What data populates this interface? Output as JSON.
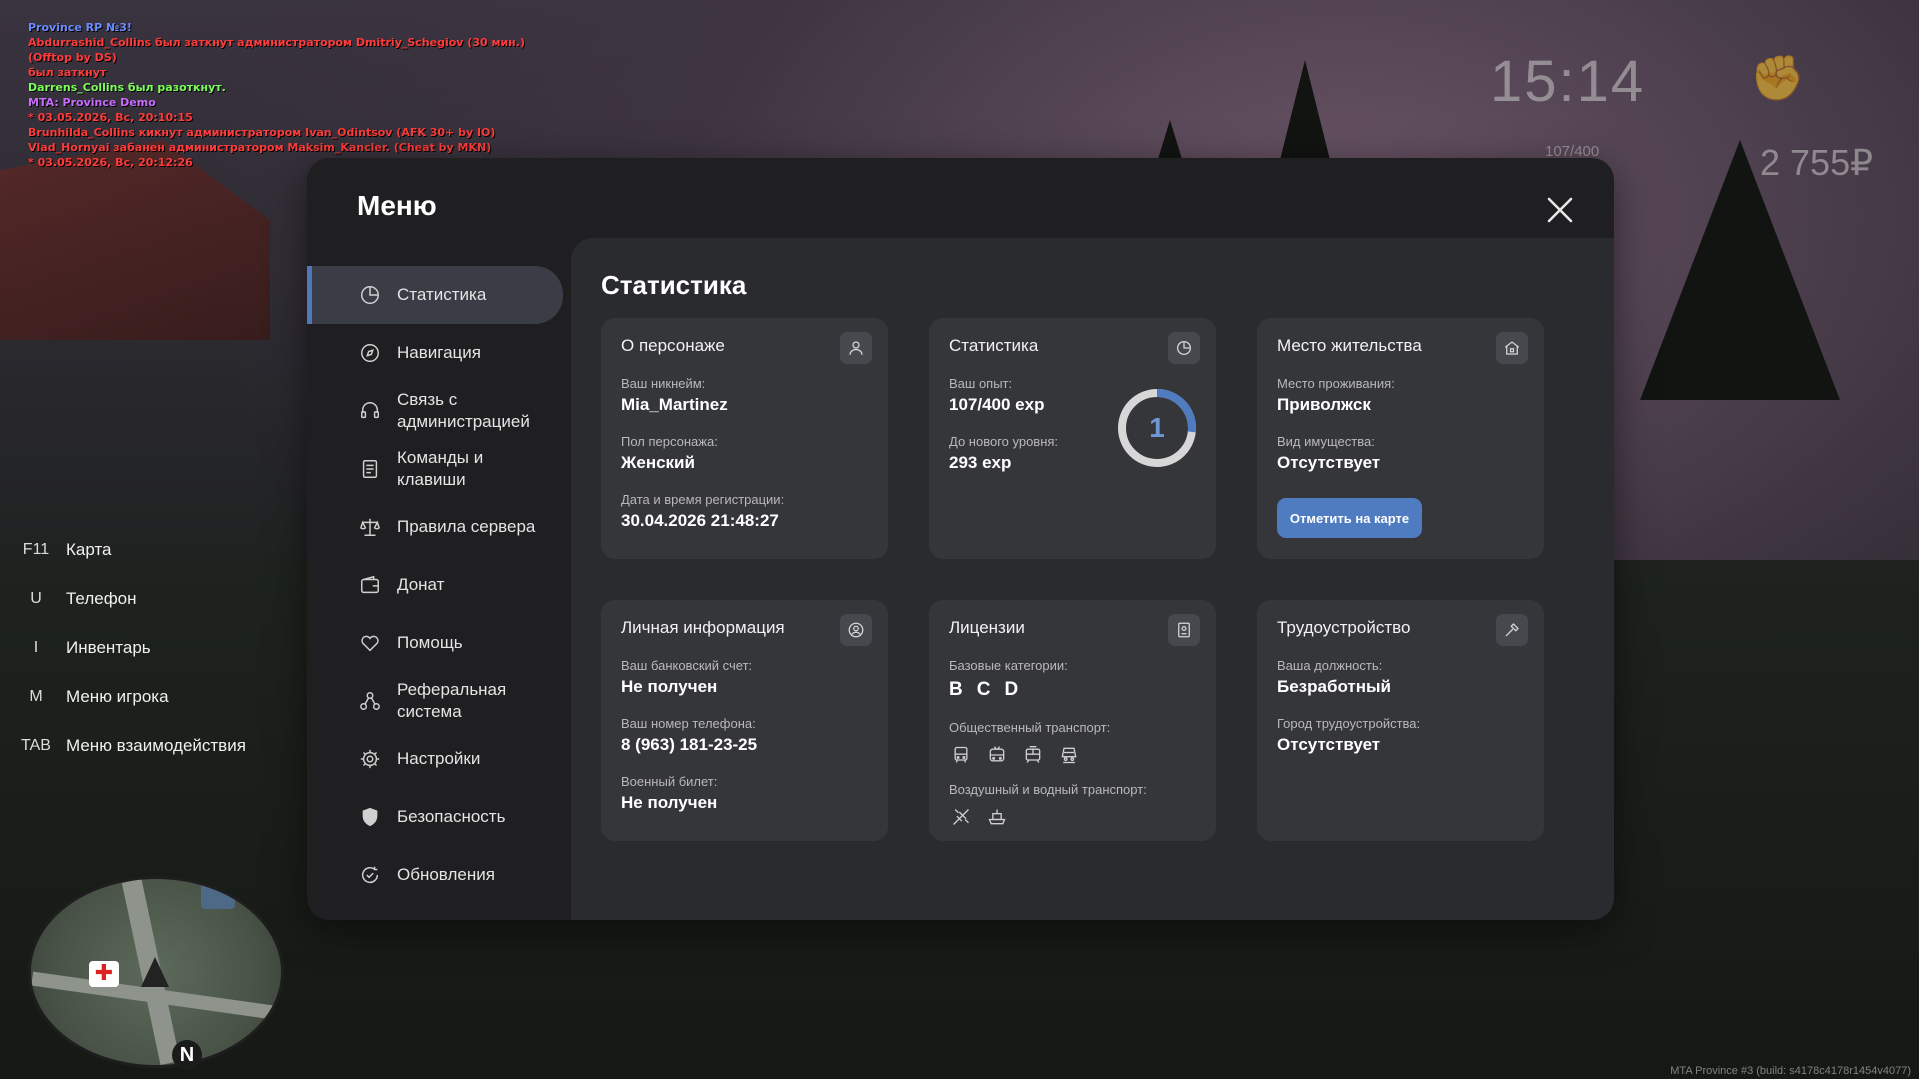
{
  "chat": [
    {
      "text": "Province RP №3!",
      "color": "#6b8cff"
    },
    {
      "text": "Abdurrashid_Collins был заткнут администратором Dmitriy_Schegiov (30 мин.)",
      "color": "#ff3b3b"
    },
    {
      "text": "(Offtop by DS)",
      "color": "#ff3b3b"
    },
    {
      "text": "был заткнут",
      "color": "#ff3b3b"
    },
    {
      "text": "Darrens_Collins был разоткнут.",
      "color": "#7cff5a"
    },
    {
      "text": "MTA: Province Demo",
      "color": "#c96bff"
    },
    {
      "text": "* 03.05.2026, Вс, 20:10:15",
      "color": "#ff3b3b"
    },
    {
      "text": "Brunhilda_Collins кикнут администратором Ivan_Odintsov (AFK 30+ by IO)",
      "color": "#ff3b3b"
    },
    {
      "text": "Vlad_Hornyai забанен администратором Maksim_Kancler. (Cheat by MKN)",
      "color": "#ff3b3b"
    },
    {
      "text": "* 03.05.2026, Вс, 20:12:26",
      "color": "#ff3b3b"
    }
  ],
  "hud": {
    "time": "15:14",
    "exp": "107/400",
    "money": "2 755₽"
  },
  "hotkeys": [
    {
      "key": "F11",
      "label": "Карта"
    },
    {
      "key": "U",
      "label": "Телефон"
    },
    {
      "key": "I",
      "label": "Инвентарь"
    },
    {
      "key": "M",
      "label": "Меню игрока"
    },
    {
      "key": "TAB",
      "label": "Меню взаимодействия"
    }
  ],
  "minimap": {
    "north": "N"
  },
  "build": "MTA Province #3 (build: s4178c4178r1454v4077)",
  "menu": {
    "title": "Меню",
    "sidebar": [
      {
        "label": "Статистика",
        "icon": "pie-chart-icon",
        "active": true
      },
      {
        "label": "Навигация",
        "icon": "compass-icon"
      },
      {
        "label": "Связь с администрацией",
        "icon": "headset-icon"
      },
      {
        "label": "Команды и клавиши",
        "icon": "document-icon"
      },
      {
        "label": "Правила сервера",
        "icon": "scales-icon"
      },
      {
        "label": "Донат",
        "icon": "wallet-icon"
      },
      {
        "label": "Помощь",
        "icon": "heart-hand-icon"
      },
      {
        "label": "Реферальная система",
        "icon": "referral-icon"
      },
      {
        "label": "Настройки",
        "icon": "gear-icon"
      },
      {
        "label": "Безопасность",
        "icon": "shield-icon"
      },
      {
        "label": "Обновления",
        "icon": "refresh-check-icon"
      }
    ],
    "content_title": "Статистика",
    "cards": {
      "character": {
        "title": "О персонаже",
        "nick_label": "Ваш никнейм:",
        "nick": "Mia_Martinez",
        "gender_label": "Пол персонажа:",
        "gender": "Женский",
        "reg_label": "Дата и время регистрации:",
        "reg": "30.04.2026 21:48:27"
      },
      "stats": {
        "title": "Статистика",
        "exp_label": "Ваш опыт:",
        "exp": "107/400 exp",
        "next_label": "До нового уровня:",
        "next": "293 exp",
        "level": "1",
        "progress": 0.2675
      },
      "residence": {
        "title": "Место жительства",
        "place_label": "Место проживания:",
        "place": "Приволжск",
        "property_label": "Вид имущества:",
        "property": "Отсутствует",
        "button": "Отметить на карте"
      },
      "personal": {
        "title": "Личная информация",
        "bank_label": "Ваш банковский счет:",
        "bank": "Не получен",
        "phone_label": "Ваш номер телефона:",
        "phone": "8 (963) 181-23-25",
        "military_label": "Военный билет:",
        "military": "Не получен"
      },
      "licenses": {
        "title": "Лицензии",
        "base_label": "Базовые категории:",
        "base": [
          "B",
          "C",
          "D"
        ],
        "public_label": "Общественный транспорт:",
        "air_label": "Воздушный и водный транспорт:"
      },
      "job": {
        "title": "Трудоустройство",
        "position_label": "Ваша должность:",
        "position": "Безработный",
        "city_label": "Город трудоустройства:",
        "city": "Отсутствует"
      }
    }
  }
}
